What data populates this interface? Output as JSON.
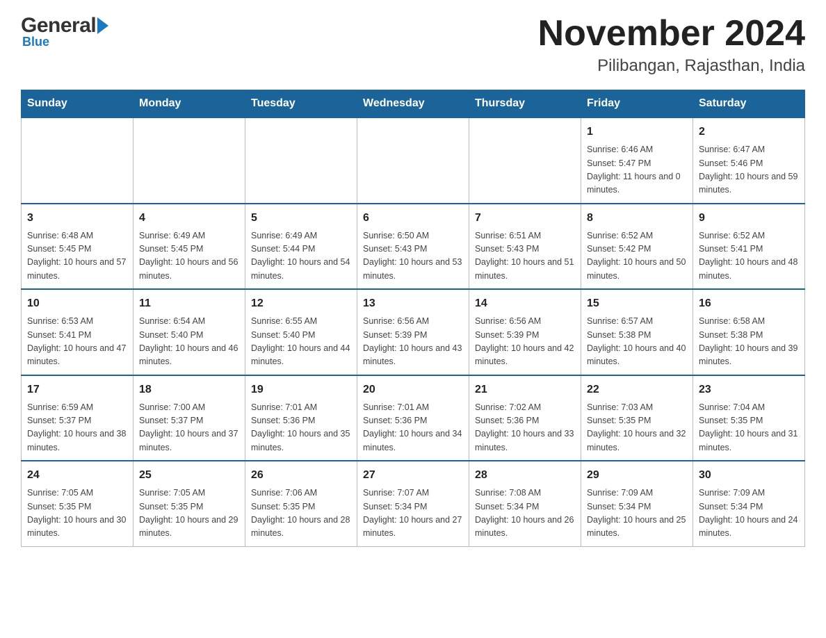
{
  "header": {
    "logo_general": "General",
    "logo_blue": "Blue",
    "month_title": "November 2024",
    "location": "Pilibangan, Rajasthan, India"
  },
  "weekdays": [
    "Sunday",
    "Monday",
    "Tuesday",
    "Wednesday",
    "Thursday",
    "Friday",
    "Saturday"
  ],
  "weeks": [
    [
      {
        "day": "",
        "sunrise": "",
        "sunset": "",
        "daylight": ""
      },
      {
        "day": "",
        "sunrise": "",
        "sunset": "",
        "daylight": ""
      },
      {
        "day": "",
        "sunrise": "",
        "sunset": "",
        "daylight": ""
      },
      {
        "day": "",
        "sunrise": "",
        "sunset": "",
        "daylight": ""
      },
      {
        "day": "",
        "sunrise": "",
        "sunset": "",
        "daylight": ""
      },
      {
        "day": "1",
        "sunrise": "Sunrise: 6:46 AM",
        "sunset": "Sunset: 5:47 PM",
        "daylight": "Daylight: 11 hours and 0 minutes."
      },
      {
        "day": "2",
        "sunrise": "Sunrise: 6:47 AM",
        "sunset": "Sunset: 5:46 PM",
        "daylight": "Daylight: 10 hours and 59 minutes."
      }
    ],
    [
      {
        "day": "3",
        "sunrise": "Sunrise: 6:48 AM",
        "sunset": "Sunset: 5:45 PM",
        "daylight": "Daylight: 10 hours and 57 minutes."
      },
      {
        "day": "4",
        "sunrise": "Sunrise: 6:49 AM",
        "sunset": "Sunset: 5:45 PM",
        "daylight": "Daylight: 10 hours and 56 minutes."
      },
      {
        "day": "5",
        "sunrise": "Sunrise: 6:49 AM",
        "sunset": "Sunset: 5:44 PM",
        "daylight": "Daylight: 10 hours and 54 minutes."
      },
      {
        "day": "6",
        "sunrise": "Sunrise: 6:50 AM",
        "sunset": "Sunset: 5:43 PM",
        "daylight": "Daylight: 10 hours and 53 minutes."
      },
      {
        "day": "7",
        "sunrise": "Sunrise: 6:51 AM",
        "sunset": "Sunset: 5:43 PM",
        "daylight": "Daylight: 10 hours and 51 minutes."
      },
      {
        "day": "8",
        "sunrise": "Sunrise: 6:52 AM",
        "sunset": "Sunset: 5:42 PM",
        "daylight": "Daylight: 10 hours and 50 minutes."
      },
      {
        "day": "9",
        "sunrise": "Sunrise: 6:52 AM",
        "sunset": "Sunset: 5:41 PM",
        "daylight": "Daylight: 10 hours and 48 minutes."
      }
    ],
    [
      {
        "day": "10",
        "sunrise": "Sunrise: 6:53 AM",
        "sunset": "Sunset: 5:41 PM",
        "daylight": "Daylight: 10 hours and 47 minutes."
      },
      {
        "day": "11",
        "sunrise": "Sunrise: 6:54 AM",
        "sunset": "Sunset: 5:40 PM",
        "daylight": "Daylight: 10 hours and 46 minutes."
      },
      {
        "day": "12",
        "sunrise": "Sunrise: 6:55 AM",
        "sunset": "Sunset: 5:40 PM",
        "daylight": "Daylight: 10 hours and 44 minutes."
      },
      {
        "day": "13",
        "sunrise": "Sunrise: 6:56 AM",
        "sunset": "Sunset: 5:39 PM",
        "daylight": "Daylight: 10 hours and 43 minutes."
      },
      {
        "day": "14",
        "sunrise": "Sunrise: 6:56 AM",
        "sunset": "Sunset: 5:39 PM",
        "daylight": "Daylight: 10 hours and 42 minutes."
      },
      {
        "day": "15",
        "sunrise": "Sunrise: 6:57 AM",
        "sunset": "Sunset: 5:38 PM",
        "daylight": "Daylight: 10 hours and 40 minutes."
      },
      {
        "day": "16",
        "sunrise": "Sunrise: 6:58 AM",
        "sunset": "Sunset: 5:38 PM",
        "daylight": "Daylight: 10 hours and 39 minutes."
      }
    ],
    [
      {
        "day": "17",
        "sunrise": "Sunrise: 6:59 AM",
        "sunset": "Sunset: 5:37 PM",
        "daylight": "Daylight: 10 hours and 38 minutes."
      },
      {
        "day": "18",
        "sunrise": "Sunrise: 7:00 AM",
        "sunset": "Sunset: 5:37 PM",
        "daylight": "Daylight: 10 hours and 37 minutes."
      },
      {
        "day": "19",
        "sunrise": "Sunrise: 7:01 AM",
        "sunset": "Sunset: 5:36 PM",
        "daylight": "Daylight: 10 hours and 35 minutes."
      },
      {
        "day": "20",
        "sunrise": "Sunrise: 7:01 AM",
        "sunset": "Sunset: 5:36 PM",
        "daylight": "Daylight: 10 hours and 34 minutes."
      },
      {
        "day": "21",
        "sunrise": "Sunrise: 7:02 AM",
        "sunset": "Sunset: 5:36 PM",
        "daylight": "Daylight: 10 hours and 33 minutes."
      },
      {
        "day": "22",
        "sunrise": "Sunrise: 7:03 AM",
        "sunset": "Sunset: 5:35 PM",
        "daylight": "Daylight: 10 hours and 32 minutes."
      },
      {
        "day": "23",
        "sunrise": "Sunrise: 7:04 AM",
        "sunset": "Sunset: 5:35 PM",
        "daylight": "Daylight: 10 hours and 31 minutes."
      }
    ],
    [
      {
        "day": "24",
        "sunrise": "Sunrise: 7:05 AM",
        "sunset": "Sunset: 5:35 PM",
        "daylight": "Daylight: 10 hours and 30 minutes."
      },
      {
        "day": "25",
        "sunrise": "Sunrise: 7:05 AM",
        "sunset": "Sunset: 5:35 PM",
        "daylight": "Daylight: 10 hours and 29 minutes."
      },
      {
        "day": "26",
        "sunrise": "Sunrise: 7:06 AM",
        "sunset": "Sunset: 5:35 PM",
        "daylight": "Daylight: 10 hours and 28 minutes."
      },
      {
        "day": "27",
        "sunrise": "Sunrise: 7:07 AM",
        "sunset": "Sunset: 5:34 PM",
        "daylight": "Daylight: 10 hours and 27 minutes."
      },
      {
        "day": "28",
        "sunrise": "Sunrise: 7:08 AM",
        "sunset": "Sunset: 5:34 PM",
        "daylight": "Daylight: 10 hours and 26 minutes."
      },
      {
        "day": "29",
        "sunrise": "Sunrise: 7:09 AM",
        "sunset": "Sunset: 5:34 PM",
        "daylight": "Daylight: 10 hours and 25 minutes."
      },
      {
        "day": "30",
        "sunrise": "Sunrise: 7:09 AM",
        "sunset": "Sunset: 5:34 PM",
        "daylight": "Daylight: 10 hours and 24 minutes."
      }
    ]
  ]
}
